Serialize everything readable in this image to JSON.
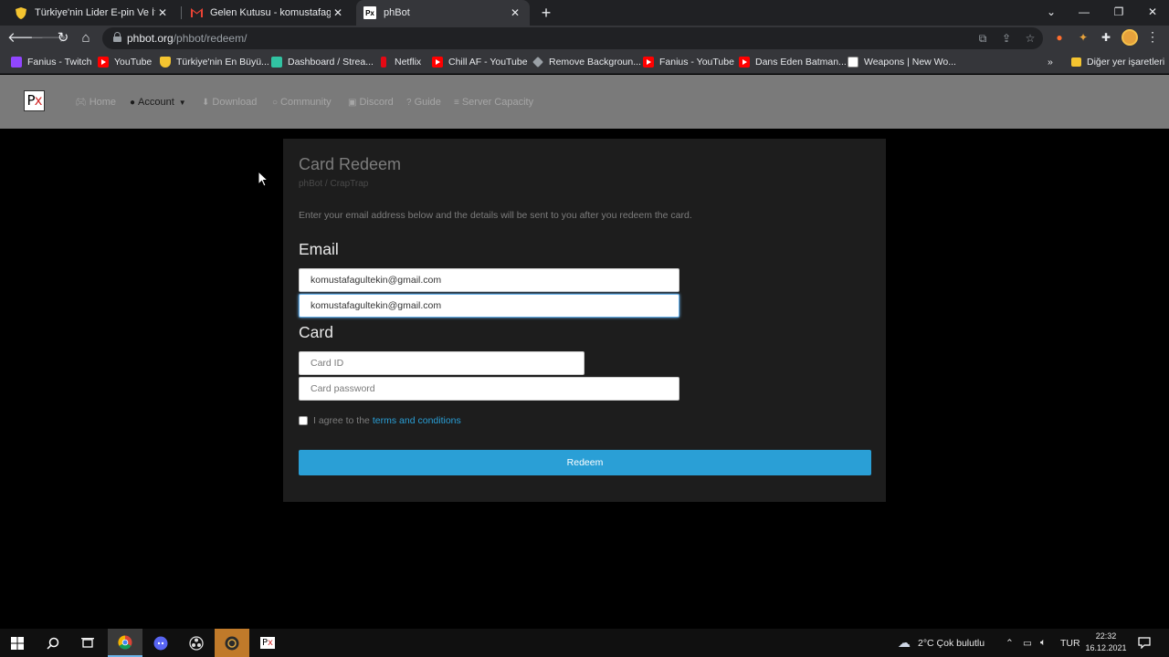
{
  "browser": {
    "tabs": [
      {
        "title": "Türkiye'nin Lider E-pin Ve İtem Pa",
        "icon": "shield-icon",
        "active": false
      },
      {
        "title": "Gelen Kutusu - komustafagultekin",
        "icon": "gmail-icon",
        "active": false
      },
      {
        "title": "phBot",
        "icon": "phbot-icon",
        "active": true
      }
    ],
    "url_host": "phbot.org",
    "url_path": "/phbot/redeem/",
    "bookmarks": [
      "Fanius - Twitch",
      "YouTube",
      "Türkiye'nin En Büyü...",
      "Dashboard / Strea...",
      "Netflix",
      "Chill AF - YouTube",
      "Remove Backgroun...",
      "Fanius - YouTube",
      "Dans Eden Batman...",
      "Weapons | New Wo..."
    ],
    "other_bookmarks": "Diğer yer işaretleri"
  },
  "site": {
    "logo_text": "Px",
    "nav": [
      {
        "label": "Home",
        "icon": "gamepad-icon",
        "active": false
      },
      {
        "label": "Account",
        "icon": "user-circle-icon",
        "active": true
      },
      {
        "label": "Download",
        "icon": "download-icon",
        "active": false
      },
      {
        "label": "Community",
        "icon": "chat-icon",
        "active": false
      },
      {
        "label": "Discord",
        "icon": "discord-icon",
        "active": false
      },
      {
        "label": "Guide",
        "icon": "question-icon",
        "active": false
      },
      {
        "label": "Server Capacity",
        "icon": "server-icon",
        "active": false
      }
    ]
  },
  "form": {
    "title": "Card Redeem",
    "breadcrumb": "phBot / CrapTrap",
    "description": "Enter your email address below and the details will be sent to you after you redeem the card.",
    "email_heading": "Email",
    "email_value": "komustafagultekin@gmail.com",
    "email_confirm_value": "komustafagultekin@gmail.com",
    "card_heading": "Card",
    "card_id_placeholder": "Card ID",
    "card_password_placeholder": "Card password",
    "agree_text": "I agree to the",
    "terms_link": "terms and conditions",
    "submit_label": "Redeem"
  },
  "taskbar": {
    "weather": "2°C  Çok bulutlu",
    "language": "TUR",
    "time": "22:32",
    "date": "16.12.2021"
  },
  "colors": {
    "accent": "#2a9fd6",
    "card_bg": "#1d1d1d",
    "nav_bg": "#7a7a7a"
  }
}
